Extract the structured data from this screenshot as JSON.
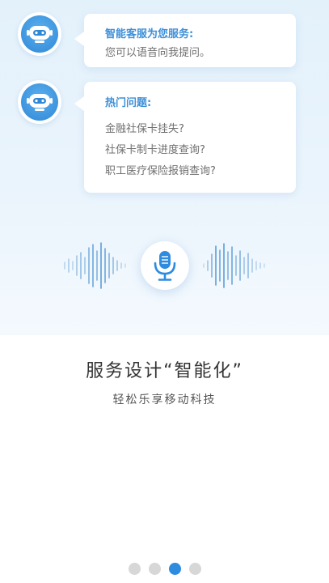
{
  "chat": {
    "greeting": {
      "title": "智能客服为您服务:",
      "text": "您可以语音向我提问。"
    },
    "hot": {
      "title": "热门问题:",
      "questions": [
        "金融社保卡挂失?",
        "社保卡制卡进度查询?",
        "职工医疗保险报销查询?"
      ]
    },
    "bot_icon": "robot-avatar-icon"
  },
  "voice": {
    "mic_icon": "microphone-icon",
    "wave_icon": "sound-wave-icon"
  },
  "intro": {
    "headline": "服务设计“智能化”",
    "subline": "轻松乐享移动科技"
  },
  "pager": {
    "count": 4,
    "active_index": 2
  },
  "colors": {
    "accent": "#2d8be0",
    "title_blue": "#3d8fd8",
    "hero_bg": "#e3f1fb",
    "dot_inactive": "#d7d7d7"
  }
}
